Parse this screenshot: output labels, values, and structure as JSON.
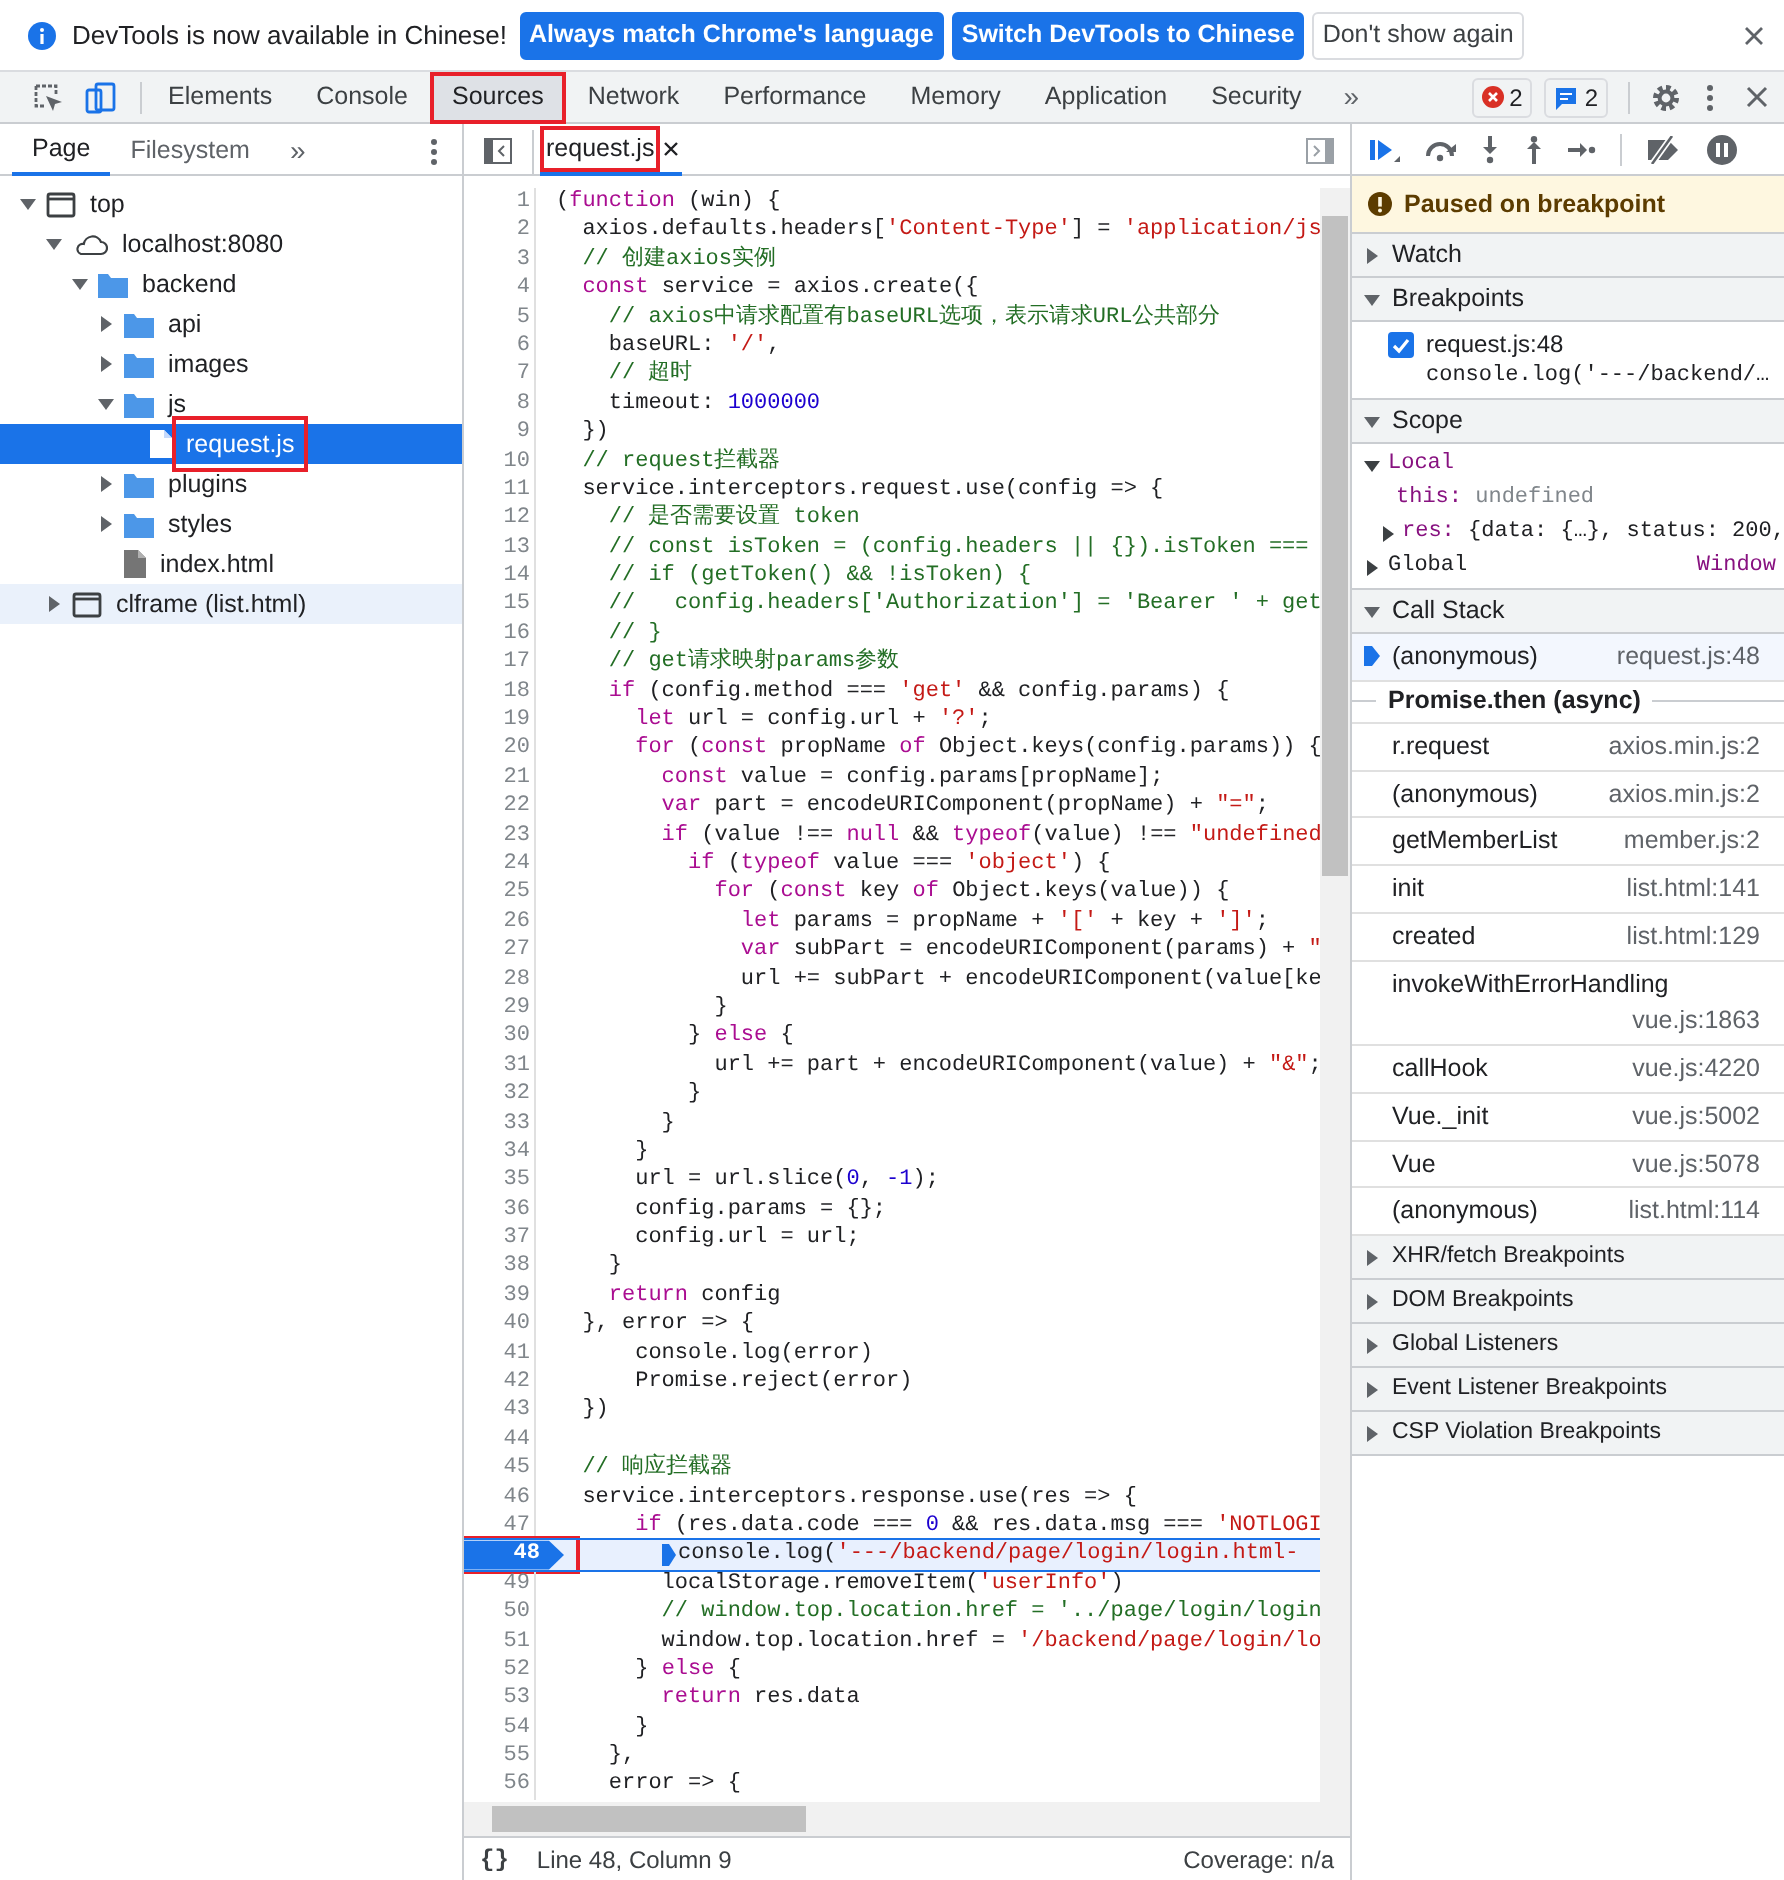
{
  "infobar": {
    "message": "DevTools is now available in Chinese!",
    "buttons": [
      {
        "label": "Always match Chrome's language",
        "kind": "primary"
      },
      {
        "label": "Switch DevTools to Chinese",
        "kind": "primary"
      },
      {
        "label": "Don't show again",
        "kind": "secondary"
      }
    ]
  },
  "main_tabs": [
    {
      "label": "Elements",
      "selected": false,
      "marked": false
    },
    {
      "label": "Console",
      "selected": false,
      "marked": false
    },
    {
      "label": "Sources",
      "selected": true,
      "marked": true
    },
    {
      "label": "Network",
      "selected": false,
      "marked": false
    },
    {
      "label": "Performance",
      "selected": false,
      "marked": false
    },
    {
      "label": "Memory",
      "selected": false,
      "marked": false
    },
    {
      "label": "Application",
      "selected": false,
      "marked": false
    },
    {
      "label": "Security",
      "selected": false,
      "marked": false
    }
  ],
  "tabs_overflow": "»",
  "error_count": "2",
  "message_count": "2",
  "navigator": {
    "tabs": [
      {
        "label": "Page",
        "selected": true
      },
      {
        "label": "Filesystem",
        "selected": false
      }
    ],
    "overflow": "»",
    "tree": [
      {
        "label": "top",
        "kind": "frame",
        "expanded": true,
        "children": [
          {
            "label": "localhost:8080",
            "kind": "cloud",
            "expanded": true,
            "children": [
              {
                "label": "backend",
                "kind": "folder",
                "expanded": true,
                "children": [
                  {
                    "label": "api",
                    "kind": "folder",
                    "expanded": false
                  },
                  {
                    "label": "images",
                    "kind": "folder",
                    "expanded": false
                  },
                  {
                    "label": "js",
                    "kind": "folder",
                    "expanded": true,
                    "children": [
                      {
                        "label": "request.js",
                        "kind": "file",
                        "selected": true,
                        "marked": true
                      }
                    ]
                  },
                  {
                    "label": "plugins",
                    "kind": "folder",
                    "expanded": false
                  },
                  {
                    "label": "styles",
                    "kind": "folder",
                    "expanded": false
                  },
                  {
                    "label": "index.html",
                    "kind": "file",
                    "selected": false,
                    "marked": false
                  }
                ]
              }
            ]
          },
          {
            "label": "clframe (list.html)",
            "kind": "frame",
            "expanded": false,
            "hovered": true
          }
        ]
      }
    ]
  },
  "editor": {
    "tab": {
      "label": "request.js",
      "marked": true
    },
    "lines": [
      {
        "number": "1",
        "paused": false,
        "code": [
          {
            "text": "(",
            "kind": "plain"
          },
          {
            "text": "function",
            "kind": "keyword"
          },
          {
            "text": " (win) {",
            "kind": "plain"
          }
        ]
      },
      {
        "number": "2",
        "paused": false,
        "code": [
          {
            "text": "  axios.defaults.headers[",
            "kind": "plain"
          },
          {
            "text": "'Content-Type'",
            "kind": "string"
          },
          {
            "text": "] = ",
            "kind": "plain"
          },
          {
            "text": "'application/js",
            "kind": "string"
          }
        ]
      },
      {
        "number": "3",
        "paused": false,
        "code": [
          {
            "text": "  // 创建axios实例",
            "kind": "comment"
          }
        ]
      },
      {
        "number": "4",
        "paused": false,
        "code": [
          {
            "text": "  const",
            "kind": "keyword"
          },
          {
            "text": " service = axios.create({",
            "kind": "plain"
          }
        ]
      },
      {
        "number": "5",
        "paused": false,
        "code": [
          {
            "text": "    // axios中请求配置有baseURL选项，表示请求URL公共部分",
            "kind": "comment"
          }
        ]
      },
      {
        "number": "6",
        "paused": false,
        "code": [
          {
            "text": "    baseURL: ",
            "kind": "plain"
          },
          {
            "text": "'/'",
            "kind": "string"
          },
          {
            "text": ",",
            "kind": "plain"
          }
        ]
      },
      {
        "number": "7",
        "paused": false,
        "code": [
          {
            "text": "    // 超时",
            "kind": "comment"
          }
        ]
      },
      {
        "number": "8",
        "paused": false,
        "code": [
          {
            "text": "    timeout: ",
            "kind": "plain"
          },
          {
            "text": "1000000",
            "kind": "number"
          }
        ]
      },
      {
        "number": "9",
        "paused": false,
        "code": [
          {
            "text": "  })",
            "kind": "plain"
          }
        ]
      },
      {
        "number": "10",
        "paused": false,
        "code": [
          {
            "text": "  // request拦截器",
            "kind": "comment"
          }
        ]
      },
      {
        "number": "11",
        "paused": false,
        "code": [
          {
            "text": "  service.interceptors.request.use(config => {",
            "kind": "plain"
          }
        ]
      },
      {
        "number": "12",
        "paused": false,
        "code": [
          {
            "text": "    // 是否需要设置 token",
            "kind": "comment"
          }
        ]
      },
      {
        "number": "13",
        "paused": false,
        "code": [
          {
            "text": "    // const isToken = (config.headers || {}).isToken ===",
            "kind": "comment"
          }
        ]
      },
      {
        "number": "14",
        "paused": false,
        "code": [
          {
            "text": "    // if (getToken() && !isToken) {",
            "kind": "comment"
          }
        ]
      },
      {
        "number": "15",
        "paused": false,
        "code": [
          {
            "text": "    //   config.headers['Authorization'] = 'Bearer ' + get",
            "kind": "comment"
          }
        ]
      },
      {
        "number": "16",
        "paused": false,
        "code": [
          {
            "text": "    // }",
            "kind": "comment"
          }
        ]
      },
      {
        "number": "17",
        "paused": false,
        "code": [
          {
            "text": "    // get请求映射params参数",
            "kind": "comment"
          }
        ]
      },
      {
        "number": "18",
        "paused": false,
        "code": [
          {
            "text": "    if",
            "kind": "keyword"
          },
          {
            "text": " (config.method === ",
            "kind": "plain"
          },
          {
            "text": "'get'",
            "kind": "string"
          },
          {
            "text": " && config.params) {",
            "kind": "plain"
          }
        ]
      },
      {
        "number": "19",
        "paused": false,
        "code": [
          {
            "text": "      let",
            "kind": "keyword"
          },
          {
            "text": " url = config.url + ",
            "kind": "plain"
          },
          {
            "text": "'?'",
            "kind": "string"
          },
          {
            "text": ";",
            "kind": "plain"
          }
        ]
      },
      {
        "number": "20",
        "paused": false,
        "code": [
          {
            "text": "      for",
            "kind": "keyword"
          },
          {
            "text": " (",
            "kind": "plain"
          },
          {
            "text": "const",
            "kind": "keyword"
          },
          {
            "text": " propName ",
            "kind": "plain"
          },
          {
            "text": "of",
            "kind": "keyword"
          },
          {
            "text": " Object.keys(config.params)) {",
            "kind": "plain"
          }
        ]
      },
      {
        "number": "21",
        "paused": false,
        "code": [
          {
            "text": "        const",
            "kind": "keyword"
          },
          {
            "text": " value = config.params[propName];",
            "kind": "plain"
          }
        ]
      },
      {
        "number": "22",
        "paused": false,
        "code": [
          {
            "text": "        var",
            "kind": "keyword"
          },
          {
            "text": " part = encodeURIComponent(propName) + ",
            "kind": "plain"
          },
          {
            "text": "\"=\"",
            "kind": "string"
          },
          {
            "text": ";",
            "kind": "plain"
          }
        ]
      },
      {
        "number": "23",
        "paused": false,
        "code": [
          {
            "text": "        if",
            "kind": "keyword"
          },
          {
            "text": " (value !== ",
            "kind": "plain"
          },
          {
            "text": "null",
            "kind": "keyword"
          },
          {
            "text": " && ",
            "kind": "plain"
          },
          {
            "text": "typeof",
            "kind": "keyword"
          },
          {
            "text": "(value) !== ",
            "kind": "plain"
          },
          {
            "text": "\"undefined",
            "kind": "string"
          }
        ]
      },
      {
        "number": "24",
        "paused": false,
        "code": [
          {
            "text": "          if",
            "kind": "keyword"
          },
          {
            "text": " (",
            "kind": "plain"
          },
          {
            "text": "typeof",
            "kind": "keyword"
          },
          {
            "text": " value === ",
            "kind": "plain"
          },
          {
            "text": "'object'",
            "kind": "string"
          },
          {
            "text": ") {",
            "kind": "plain"
          }
        ]
      },
      {
        "number": "25",
        "paused": false,
        "code": [
          {
            "text": "            for",
            "kind": "keyword"
          },
          {
            "text": " (",
            "kind": "plain"
          },
          {
            "text": "const",
            "kind": "keyword"
          },
          {
            "text": " key ",
            "kind": "plain"
          },
          {
            "text": "of",
            "kind": "keyword"
          },
          {
            "text": " Object.keys(value)) {",
            "kind": "plain"
          }
        ]
      },
      {
        "number": "26",
        "paused": false,
        "code": [
          {
            "text": "              let",
            "kind": "keyword"
          },
          {
            "text": " params = propName + ",
            "kind": "plain"
          },
          {
            "text": "'['",
            "kind": "string"
          },
          {
            "text": " + key + ",
            "kind": "plain"
          },
          {
            "text": "']'",
            "kind": "string"
          },
          {
            "text": ";",
            "kind": "plain"
          }
        ]
      },
      {
        "number": "27",
        "paused": false,
        "code": [
          {
            "text": "              var",
            "kind": "keyword"
          },
          {
            "text": " subPart = encodeURIComponent(params) + ",
            "kind": "plain"
          },
          {
            "text": "\"",
            "kind": "string"
          }
        ]
      },
      {
        "number": "28",
        "paused": false,
        "code": [
          {
            "text": "              url += subPart + encodeURIComponent(value[ke",
            "kind": "plain"
          }
        ]
      },
      {
        "number": "29",
        "paused": false,
        "code": [
          {
            "text": "            }",
            "kind": "plain"
          }
        ]
      },
      {
        "number": "30",
        "paused": false,
        "code": [
          {
            "text": "          } ",
            "kind": "plain"
          },
          {
            "text": "else",
            "kind": "keyword"
          },
          {
            "text": " {",
            "kind": "plain"
          }
        ]
      },
      {
        "number": "31",
        "paused": false,
        "code": [
          {
            "text": "            url += part + encodeURIComponent(value) + ",
            "kind": "plain"
          },
          {
            "text": "\"&\"",
            "kind": "string"
          },
          {
            "text": ";",
            "kind": "plain"
          }
        ]
      },
      {
        "number": "32",
        "paused": false,
        "code": [
          {
            "text": "          }",
            "kind": "plain"
          }
        ]
      },
      {
        "number": "33",
        "paused": false,
        "code": [
          {
            "text": "        }",
            "kind": "plain"
          }
        ]
      },
      {
        "number": "34",
        "paused": false,
        "code": [
          {
            "text": "      }",
            "kind": "plain"
          }
        ]
      },
      {
        "number": "35",
        "paused": false,
        "code": [
          {
            "text": "      url = url.slice(",
            "kind": "plain"
          },
          {
            "text": "0",
            "kind": "number"
          },
          {
            "text": ", ",
            "kind": "plain"
          },
          {
            "text": "-1",
            "kind": "number"
          },
          {
            "text": ");",
            "kind": "plain"
          }
        ]
      },
      {
        "number": "36",
        "paused": false,
        "code": [
          {
            "text": "      config.params = {};",
            "kind": "plain"
          }
        ]
      },
      {
        "number": "37",
        "paused": false,
        "code": [
          {
            "text": "      config.url = url;",
            "kind": "plain"
          }
        ]
      },
      {
        "number": "38",
        "paused": false,
        "code": [
          {
            "text": "    }",
            "kind": "plain"
          }
        ]
      },
      {
        "number": "39",
        "paused": false,
        "code": [
          {
            "text": "    return",
            "kind": "keyword"
          },
          {
            "text": " config",
            "kind": "plain"
          }
        ]
      },
      {
        "number": "40",
        "paused": false,
        "code": [
          {
            "text": "  }, error => {",
            "kind": "plain"
          }
        ]
      },
      {
        "number": "41",
        "paused": false,
        "code": [
          {
            "text": "      console.log(error)",
            "kind": "plain"
          }
        ]
      },
      {
        "number": "42",
        "paused": false,
        "code": [
          {
            "text": "      Promise.reject(error)",
            "kind": "plain"
          }
        ]
      },
      {
        "number": "43",
        "paused": false,
        "code": [
          {
            "text": "  })",
            "kind": "plain"
          }
        ]
      },
      {
        "number": "44",
        "paused": false
      },
      {
        "number": "45",
        "paused": false,
        "code": [
          {
            "text": "  // 响应拦截器",
            "kind": "comment"
          }
        ]
      },
      {
        "number": "46",
        "paused": false,
        "code": [
          {
            "text": "  service.interceptors.response.use(res => {",
            "kind": "plain"
          }
        ]
      },
      {
        "number": "47",
        "paused": false,
        "code": [
          {
            "text": "      if",
            "kind": "keyword"
          },
          {
            "text": " (res.data.code === ",
            "kind": "plain"
          },
          {
            "text": "0",
            "kind": "number"
          },
          {
            "text": " && res.data.msg === ",
            "kind": "plain"
          },
          {
            "text": "'NOTLOGI",
            "kind": "string"
          }
        ]
      },
      {
        "number": "48",
        "paused": true,
        "marked": true,
        "code": [
          {
            "text": "console.log(",
            "kind": "plain"
          },
          {
            "text": "'---/backend/page/login/login.html-",
            "kind": "string"
          }
        ]
      },
      {
        "number": "49",
        "paused": false,
        "code": [
          {
            "text": "        localStorage.removeItem(",
            "kind": "plain"
          },
          {
            "text": "'userInfo'",
            "kind": "string"
          },
          {
            "text": ")",
            "kind": "plain"
          }
        ]
      },
      {
        "number": "50",
        "paused": false,
        "code": [
          {
            "text": "        // window.top.location.href = '../page/login/login",
            "kind": "comment"
          }
        ]
      },
      {
        "number": "51",
        "paused": false,
        "code": [
          {
            "text": "        window.top.location.href = ",
            "kind": "plain"
          },
          {
            "text": "'/backend/page/login/lo",
            "kind": "string"
          }
        ]
      },
      {
        "number": "52",
        "paused": false,
        "code": [
          {
            "text": "      } ",
            "kind": "plain"
          },
          {
            "text": "else",
            "kind": "keyword"
          },
          {
            "text": " {",
            "kind": "plain"
          }
        ]
      },
      {
        "number": "53",
        "paused": false,
        "code": [
          {
            "text": "        return",
            "kind": "keyword"
          },
          {
            "text": " res.data",
            "kind": "plain"
          }
        ]
      },
      {
        "number": "54",
        "paused": false,
        "code": [
          {
            "text": "      }",
            "kind": "plain"
          }
        ]
      },
      {
        "number": "55",
        "paused": false,
        "code": [
          {
            "text": "    },",
            "kind": "plain"
          }
        ]
      },
      {
        "number": "56",
        "paused": false,
        "code": [
          {
            "text": "    error => {",
            "kind": "plain"
          }
        ]
      }
    ],
    "format_button": "{}",
    "position": "Line 48, Column 9",
    "coverage": "Coverage: n/a"
  },
  "debugger": {
    "banner": "Paused on breakpoint",
    "watch": {
      "title": "Watch",
      "expanded": false
    },
    "breakpoints": {
      "title": "Breakpoints",
      "expanded": true,
      "items": [
        {
          "location": "request.js:48",
          "code": "console.log('---/backend/…",
          "checked": true
        }
      ]
    },
    "scope": {
      "title": "Scope",
      "expanded": true,
      "scopes": [
        {
          "name": "Local",
          "expanded": true,
          "entries": [
            {
              "kind": "value",
              "key": "this:",
              "value": "undefined"
            },
            {
              "kind": "object",
              "key": "res:",
              "value": "{data: {…}, status: 200,",
              "expanded": false
            }
          ]
        },
        {
          "name": "Global",
          "expanded": false,
          "value": "Window"
        }
      ]
    },
    "call_stack": {
      "title": "Call Stack",
      "expanded": true,
      "frames": [
        {
          "kind": "frame",
          "name": "(anonymous)",
          "location": "request.js:48",
          "selected": true
        },
        {
          "kind": "async",
          "label": "Promise.then (async)"
        },
        {
          "kind": "frame",
          "name": "r.request",
          "location": "axios.min.js:2",
          "selected": false
        },
        {
          "kind": "frame",
          "name": "(anonymous)",
          "location": "axios.min.js:2",
          "selected": false
        },
        {
          "kind": "frame",
          "name": "getMemberList",
          "location": "member.js:2",
          "selected": false
        },
        {
          "kind": "frame",
          "name": "init",
          "location": "list.html:141",
          "selected": false
        },
        {
          "kind": "frame",
          "name": "created",
          "location": "list.html:129",
          "selected": false
        },
        {
          "kind": "frame",
          "name": "invokeWithErrorHandling",
          "location": "vue.js:1863",
          "selected": false
        },
        {
          "kind": "frame",
          "name": "callHook",
          "location": "vue.js:4220",
          "selected": false
        },
        {
          "kind": "frame",
          "name": "Vue._init",
          "location": "vue.js:5002",
          "selected": false
        },
        {
          "kind": "frame",
          "name": "Vue",
          "location": "vue.js:5078",
          "selected": false
        },
        {
          "kind": "frame",
          "name": "(anonymous)",
          "location": "list.html:114",
          "selected": false
        }
      ]
    },
    "more_sections": [
      {
        "title": "XHR/fetch Breakpoints",
        "expanded": false
      },
      {
        "title": "DOM Breakpoints",
        "expanded": false
      },
      {
        "title": "Global Listeners",
        "expanded": false
      },
      {
        "title": "Event Listener Breakpoints",
        "expanded": false
      },
      {
        "title": "CSP Violation Breakpoints",
        "expanded": false
      }
    ]
  }
}
